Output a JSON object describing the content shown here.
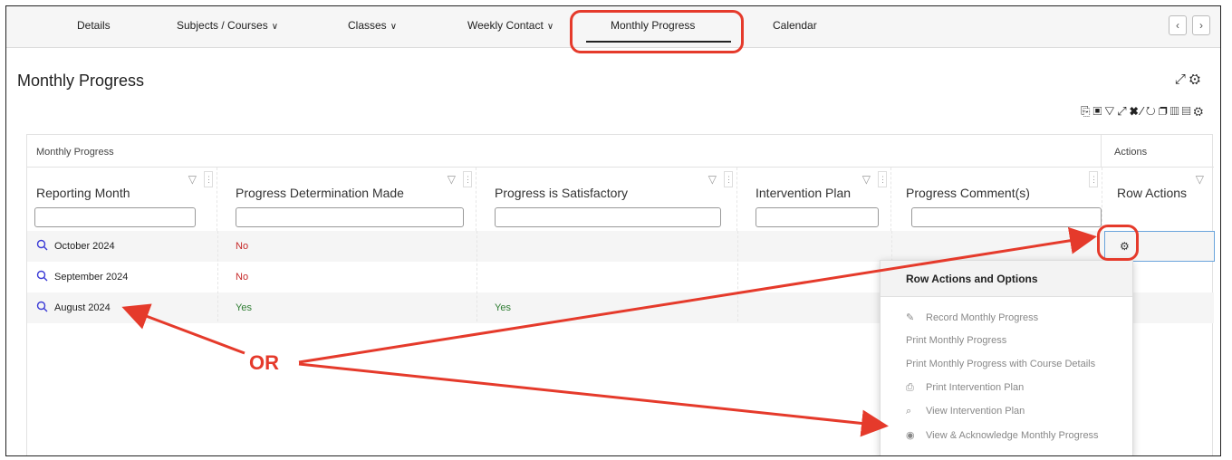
{
  "nav": {
    "tabs": [
      {
        "label": "Details",
        "dropdown": false
      },
      {
        "label": "Subjects / Courses",
        "dropdown": true
      },
      {
        "label": "Classes",
        "dropdown": true
      },
      {
        "label": "Weekly Contact",
        "dropdown": true
      },
      {
        "label": "Monthly Progress",
        "dropdown": false,
        "active": true
      },
      {
        "label": "Calendar",
        "dropdown": false
      }
    ],
    "prev_icon": "chevron-left-icon",
    "next_icon": "chevron-right-icon"
  },
  "page": {
    "title": "Monthly Progress"
  },
  "grid": {
    "group_label": "Monthly Progress",
    "actions_label": "Actions",
    "columns": [
      "Reporting Month",
      "Progress Determination Made",
      "Progress is Satisfactory",
      "Intervention Plan",
      "Progress Comment(s)",
      "Row Actions"
    ],
    "rows": [
      {
        "month": "October 2024",
        "determination": "No",
        "satisfactory": ""
      },
      {
        "month": "September 2024",
        "determination": "No",
        "satisfactory": ""
      },
      {
        "month": "August 2024",
        "determination": "Yes",
        "satisfactory": "Yes"
      }
    ]
  },
  "row_menu": {
    "title": "Row Actions and Options",
    "items": [
      {
        "label": "Record Monthly Progress",
        "icon": "edit-icon"
      },
      {
        "label": "Print Monthly Progress",
        "icon": ""
      },
      {
        "label": "Print Monthly Progress with Course Details",
        "icon": ""
      },
      {
        "label": "Print Intervention Plan",
        "icon": "printer-icon"
      },
      {
        "label": "View Intervention Plan",
        "icon": "search-icon"
      },
      {
        "label": "View & Acknowledge Monthly Progress",
        "icon": "eye-icon"
      }
    ]
  },
  "annotation": {
    "or_label": "OR",
    "color": "#e53a2b"
  }
}
